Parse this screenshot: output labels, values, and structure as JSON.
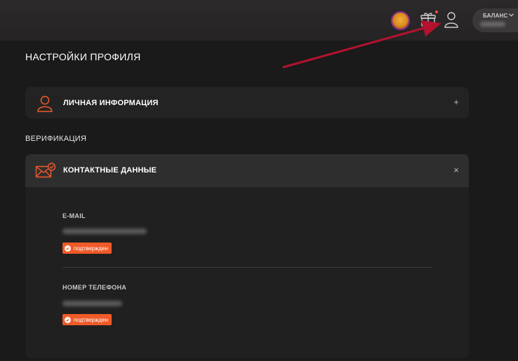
{
  "header": {
    "balance": {
      "label": "БАЛАНС"
    },
    "gift": {
      "has_notification": true
    },
    "colors": {
      "notification_dot": "#ff4a3d",
      "avatar_border": "#8c2d8f"
    }
  },
  "page": {
    "title": "НАСТРОЙКИ ПРОФИЛЯ"
  },
  "personal_info": {
    "title": "ЛИЧНАЯ ИНФОРМАЦИЯ",
    "icon": "user-icon",
    "toggle_label": "+"
  },
  "verification": {
    "section_title": "ВЕРИФИКАЦИЯ",
    "contacts": {
      "title": "КОНТАКТНЫЕ ДАННЫЕ",
      "icon": "envelope-check-icon",
      "close_label": "×",
      "fields": [
        {
          "label": "E-MAIL",
          "status": "подтвержден"
        },
        {
          "label": "НОМЕР ТЕЛЕФОНА",
          "status": "подтвержден"
        }
      ]
    }
  },
  "theme": {
    "accent": "#f05a28",
    "background": "#1a1a1a",
    "card": "#242323",
    "annotation_arrow": "#b3122e"
  }
}
